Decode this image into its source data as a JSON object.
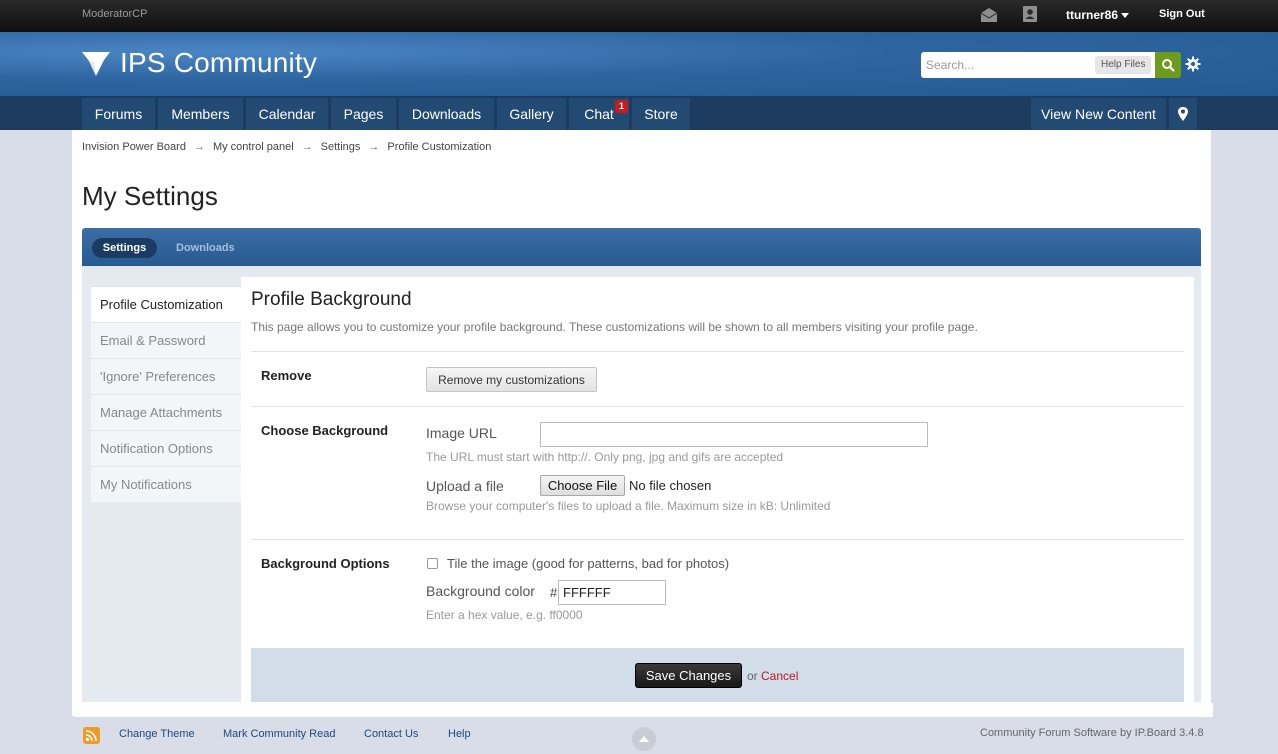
{
  "topbar": {
    "moderator_cp": "ModeratorCP",
    "username": "tturner86",
    "sign_out": "Sign Out"
  },
  "header": {
    "logo_text": "IPS Community",
    "search_placeholder": "Search...",
    "help_files": "Help Files"
  },
  "nav": {
    "items": [
      "Forums",
      "Members",
      "Calendar",
      "Pages",
      "Downloads",
      "Gallery",
      "Chat",
      "Store"
    ],
    "chat_badge": "1",
    "view_new_content": "View New Content"
  },
  "breadcrumb": {
    "items": [
      "Invision Power Board",
      "My control panel",
      "Settings",
      "Profile Customization"
    ],
    "separator": "→"
  },
  "page_title": "My Settings",
  "tabs": {
    "active": "Settings",
    "other": "Downloads"
  },
  "sidebar": {
    "items": [
      {
        "label": "Profile Customization",
        "active": true
      },
      {
        "label": "Email & Password",
        "active": false
      },
      {
        "label": "'Ignore' Preferences",
        "active": false
      },
      {
        "label": "Manage Attachments",
        "active": false
      },
      {
        "label": "Notification Options",
        "active": false
      },
      {
        "label": "My Notifications",
        "active": false
      }
    ]
  },
  "panel": {
    "title": "Profile Background",
    "description": "This page allows you to customize your profile background. These customizations will be shown to all members visiting your profile page.",
    "remove": {
      "label": "Remove",
      "button": "Remove my customizations"
    },
    "choose_background": {
      "label": "Choose Background",
      "image_url_label": "Image URL",
      "image_url_value": "",
      "image_url_hint": "The URL must start with http://. Only png, jpg and gifs are accepted",
      "upload_label": "Upload a file",
      "choose_file": "Choose File",
      "no_file": "No file chosen",
      "upload_hint": "Browse your computer's files to upload a file. Maximum size in kB: Unlimited"
    },
    "background_options": {
      "label": "Background Options",
      "tile_label": "Tile the image (good for patterns, bad for photos)",
      "tile_checked": false,
      "color_label": "Background color",
      "hash": "#",
      "color_value": "FFFFFF",
      "color_hint": "Enter a hex value, e.g. ff0000"
    },
    "save": "Save Changes",
    "or": "or",
    "cancel": "Cancel"
  },
  "footer": {
    "links": [
      "Change Theme",
      "Mark Community Read",
      "Contact Us",
      "Help"
    ],
    "copyright": "Community Forum Software by IP.Board 3.4.8"
  },
  "colors": {
    "header_blue": "#2e65a0",
    "nav_dark": "#1c3b5e",
    "search_green": "#6d9c1d",
    "cancel_red": "#ad1f1f",
    "badge_red": "#c31d1d"
  }
}
